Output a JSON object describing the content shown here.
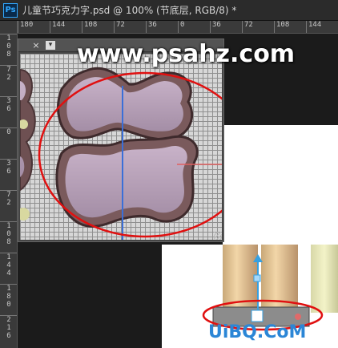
{
  "app": {
    "badge": "Ps",
    "document_title": "儿童节巧克力字.psd @ 100% (节底层, RGB/8) *"
  },
  "ruler_top": {
    "ticks": [
      "180",
      "144",
      "108",
      "72",
      "36",
      "0",
      "36",
      "72",
      "108",
      "144"
    ]
  },
  "ruler_left": {
    "ticks": [
      "108",
      "72",
      "36",
      "0",
      "36",
      "72",
      "108",
      "144",
      "180",
      "216"
    ]
  },
  "zoom_panel": {
    "close_label": "×",
    "menu_label": "▾"
  },
  "watermarks": {
    "top": "www.psahz.com",
    "bottom": "UiBQ.CoM"
  },
  "colors": {
    "annotation_red": "#e01010",
    "guide_blue": "#3a6fd8",
    "chocolate": "#7a5a5c",
    "lilac": "#b9a2b8"
  }
}
